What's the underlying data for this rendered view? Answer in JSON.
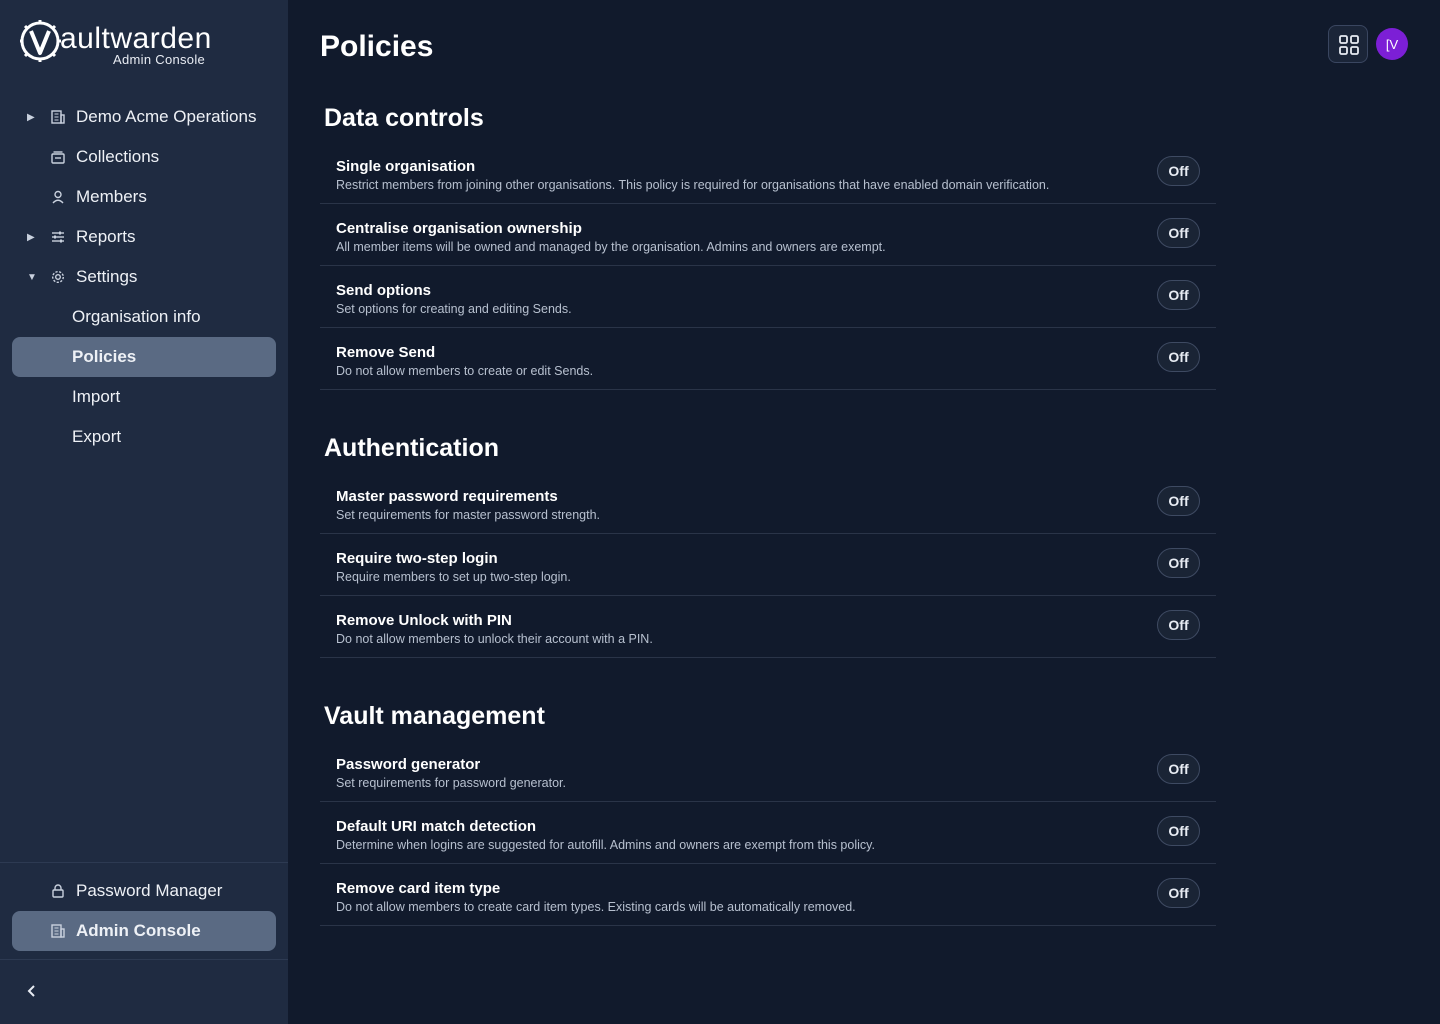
{
  "brand": {
    "name_rest": "aultwarden",
    "subtitle": "Admin Console"
  },
  "sidebar": {
    "items": [
      {
        "label": "Demo Acme Operations",
        "icon": "building-icon",
        "caret": "right"
      },
      {
        "label": "Collections",
        "icon": "collection-icon"
      },
      {
        "label": "Members",
        "icon": "user-icon"
      },
      {
        "label": "Reports",
        "icon": "sliders-icon",
        "caret": "right"
      },
      {
        "label": "Settings",
        "icon": "gear-icon",
        "caret": "down"
      },
      {
        "label": "Organisation info"
      },
      {
        "label": "Policies",
        "active": true
      },
      {
        "label": "Import"
      },
      {
        "label": "Export"
      }
    ],
    "bottom": [
      {
        "label": "Password Manager",
        "icon": "lock-icon"
      },
      {
        "label": "Admin Console",
        "icon": "building-icon",
        "active": true
      }
    ]
  },
  "header": {
    "title": "Policies",
    "avatar_initials": "[V"
  },
  "sections": [
    {
      "title": "Data controls",
      "policies": [
        {
          "title": "Single organisation",
          "desc": "Restrict members from joining other organisations. This policy is required for organisations that have enabled domain verification.",
          "status": "Off"
        },
        {
          "title": "Centralise organisation ownership",
          "desc": "All member items will be owned and managed by the organisation. Admins and owners are exempt.",
          "status": "Off"
        },
        {
          "title": "Send options",
          "desc": "Set options for creating and editing Sends.",
          "status": "Off"
        },
        {
          "title": "Remove Send",
          "desc": "Do not allow members to create or edit Sends.",
          "status": "Off"
        }
      ]
    },
    {
      "title": "Authentication",
      "policies": [
        {
          "title": "Master password requirements",
          "desc": "Set requirements for master password strength.",
          "status": "Off"
        },
        {
          "title": "Require two-step login",
          "desc": "Require members to set up two-step login.",
          "status": "Off"
        },
        {
          "title": "Remove Unlock with PIN",
          "desc": "Do not allow members to unlock their account with a PIN.",
          "status": "Off"
        }
      ]
    },
    {
      "title": "Vault management",
      "policies": [
        {
          "title": "Password generator",
          "desc": "Set requirements for password generator.",
          "status": "Off"
        },
        {
          "title": "Default URI match detection",
          "desc": "Determine when logins are suggested for autofill. Admins and owners are exempt from this policy.",
          "status": "Off"
        },
        {
          "title": "Remove card item type",
          "desc": "Do not allow members to create card item types. Existing cards will be automatically removed.",
          "status": "Off"
        }
      ]
    }
  ]
}
